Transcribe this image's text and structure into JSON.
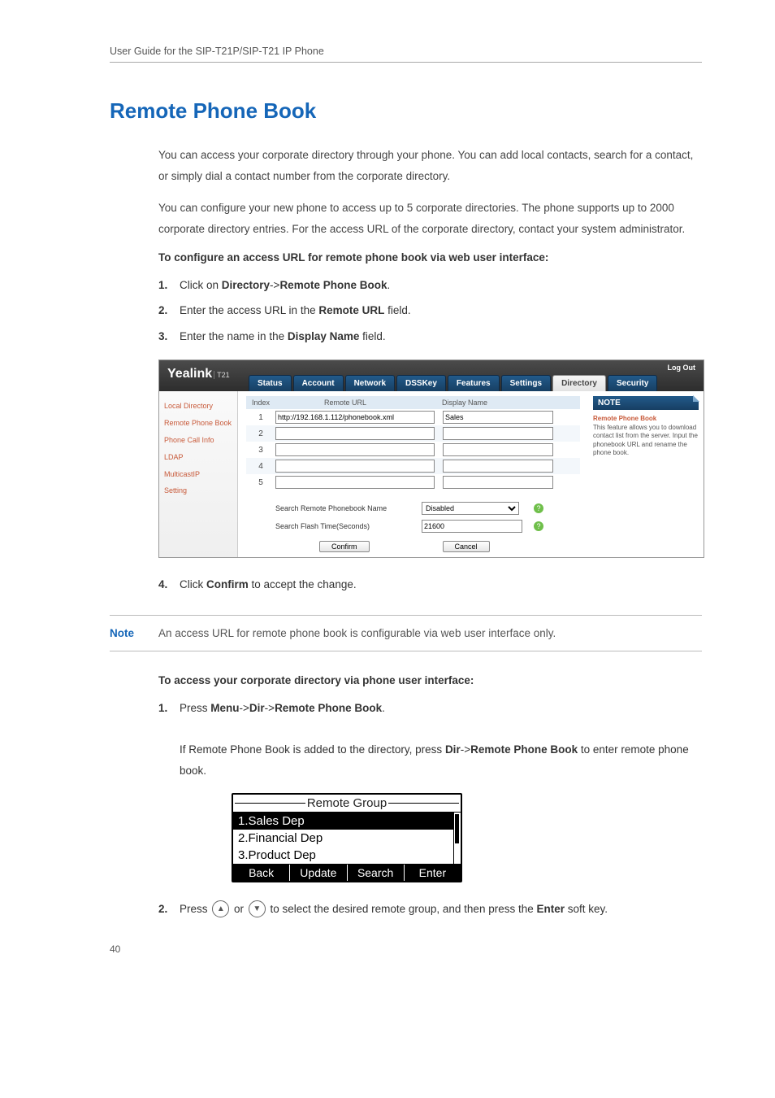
{
  "header": "User Guide for the SIP-T21P/SIP-T21 IP Phone",
  "title": "Remote Phone Book",
  "para1": "You can access your corporate directory through your phone. You can add local contacts, search for a contact, or simply dial a contact number from the corporate directory.",
  "para2": "You can configure your new phone to access up to 5 corporate directories. The phone supports up to 2000 corporate directory entries. For the access URL of the corporate directory, contact your system administrator.",
  "proc1_title": "To configure an access URL for remote phone book via web user interface:",
  "steps1": {
    "s1_pre": "Click on ",
    "s1_b1": "Directory",
    "s1_mid": "->",
    "s1_b2": "Remote Phone Book",
    "s1_post": ".",
    "s2_pre": "Enter the access URL in the ",
    "s2_b": "Remote URL",
    "s2_post": " field.",
    "s3_pre": "Enter the name in the ",
    "s3_b": "Display Name",
    "s3_post": " field."
  },
  "shot": {
    "logo": "Yealink",
    "logo_sub": "T21",
    "logout": "Log Out",
    "tabs": [
      "Status",
      "Account",
      "Network",
      "DSSKey",
      "Features",
      "Settings",
      "Directory",
      "Security"
    ],
    "active_tab": "Directory",
    "side": [
      "Local Directory",
      "Remote Phone Book",
      "Phone Call Info",
      "LDAP",
      "MulticastIP",
      "Setting"
    ],
    "thead": {
      "idx": "Index",
      "url": "Remote URL",
      "name": "Display Name"
    },
    "rows": [
      {
        "i": "1",
        "url": "http://192.168.1.112/phonebook.xml",
        "name": "Sales"
      },
      {
        "i": "2",
        "url": "",
        "name": ""
      },
      {
        "i": "3",
        "url": "",
        "name": ""
      },
      {
        "i": "4",
        "url": "",
        "name": ""
      },
      {
        "i": "5",
        "url": "",
        "name": ""
      }
    ],
    "opt1_label": "Search Remote Phonebook Name",
    "opt1_value": "Disabled",
    "opt2_label": "Search Flash Time(Seconds)",
    "opt2_value": "21600",
    "confirm": "Confirm",
    "cancel": "Cancel",
    "note_hdr": "NOTE",
    "note_ttl": "Remote Phone Book",
    "note_desc": "This feature allows you to download contact list from the server. Input the phonebook URL and rename the phone book."
  },
  "step4_pre": "Click ",
  "step4_b": "Confirm",
  "step4_post": " to accept the change.",
  "note_label": "Note",
  "note_text": "An access URL for remote phone book is configurable via web user interface only.",
  "proc2_title": "To access your corporate directory via phone user interface:",
  "steps2": {
    "s1_pre": "Press ",
    "s1_b1": "Menu",
    "s1_m1": "->",
    "s1_b2": "Dir",
    "s1_m2": "->",
    "s1_b3": "Remote Phone Book",
    "s1_post": ".",
    "s1_line2_pre": "If Remote Phone Book is added to the directory, press ",
    "s1_line2_b1": "Dir",
    "s1_line2_m": "->",
    "s1_line2_b2": "Remote Phone Book",
    "s1_line2_post": " to enter remote phone book."
  },
  "phone": {
    "title": "Remote Group",
    "items": [
      "1.Sales Dep",
      "2.Financial Dep",
      "3.Product Dep"
    ],
    "soft": [
      "Back",
      "Update",
      "Search",
      "Enter"
    ]
  },
  "step2b_pre": "Press ",
  "step2b_mid": " or ",
  "step2b_post": " to select the desired remote group, and then press the ",
  "step2b_b": "Enter",
  "step2b_tail": " soft key.",
  "up_glyph": "▲",
  "down_glyph": "▼",
  "pagenum": "40"
}
